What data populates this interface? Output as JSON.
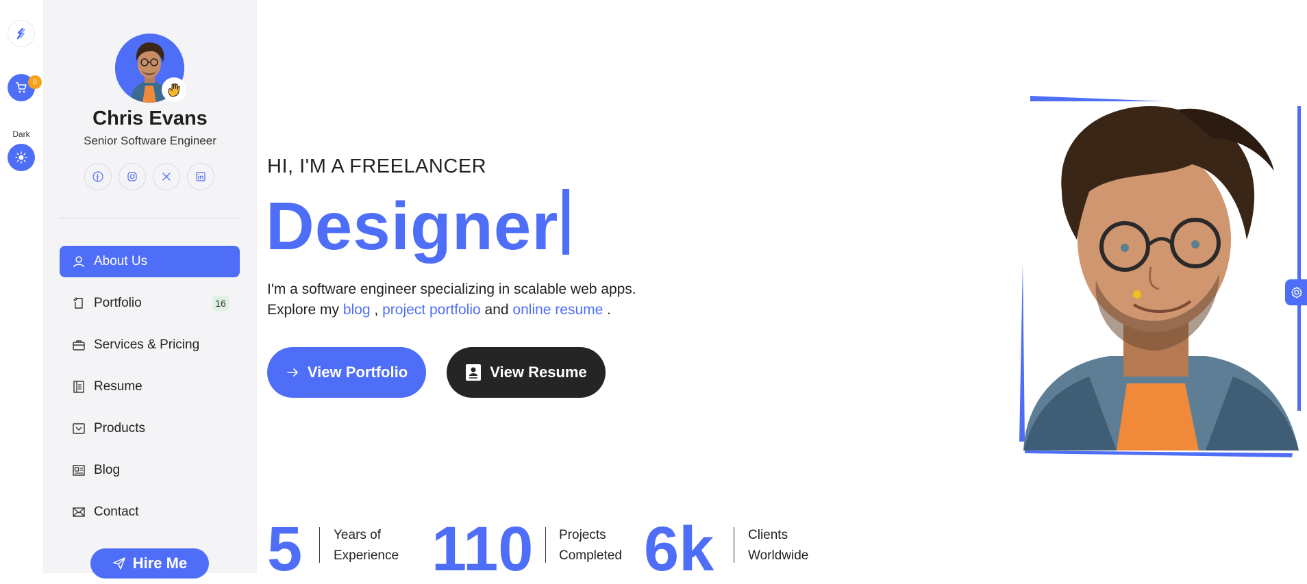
{
  "rail": {
    "cart_count": "0",
    "theme_label": "Dark"
  },
  "profile": {
    "name": "Chris Evans",
    "role": "Senior Software Engineer",
    "socials": [
      "facebook-icon",
      "instagram-icon",
      "x-icon",
      "linkedin-icon"
    ]
  },
  "nav": {
    "items": [
      {
        "label": "About Us",
        "icon": "user-icon",
        "active": true
      },
      {
        "label": "Portfolio",
        "icon": "portfolio-icon",
        "badge": "16"
      },
      {
        "label": "Services & Pricing",
        "icon": "briefcase-icon"
      },
      {
        "label": "Resume",
        "icon": "resume-icon"
      },
      {
        "label": "Products",
        "icon": "products-icon"
      },
      {
        "label": "Blog",
        "icon": "blog-icon"
      },
      {
        "label": "Contact",
        "icon": "mail-icon"
      }
    ],
    "hire_label": "Hire Me"
  },
  "hero": {
    "kicker": "HI, I'M A FREELANCER",
    "headline": "Designer",
    "intro_line1": "I'm a software engineer specializing in scalable web apps.",
    "intro_prefix": "Explore my",
    "link_blog": "blog",
    "sep1": ",",
    "link_portfolio": "project portfolio",
    "sep2": "and",
    "link_resume": "online resume",
    "sep3": ".",
    "btn_portfolio": "View Portfolio",
    "btn_resume": "View Resume"
  },
  "stats": [
    {
      "value": "5",
      "label1": "Years of",
      "label2": "Experience"
    },
    {
      "value": "110",
      "label1": "Projects",
      "label2": "Completed"
    },
    {
      "value": "6k",
      "label1": "Clients",
      "label2": "Worldwide"
    }
  ],
  "colors": {
    "accent": "#4f6ef7",
    "dark": "#252525",
    "sidebar_bg": "#f4f4f6",
    "badge": "#f7a21b"
  }
}
